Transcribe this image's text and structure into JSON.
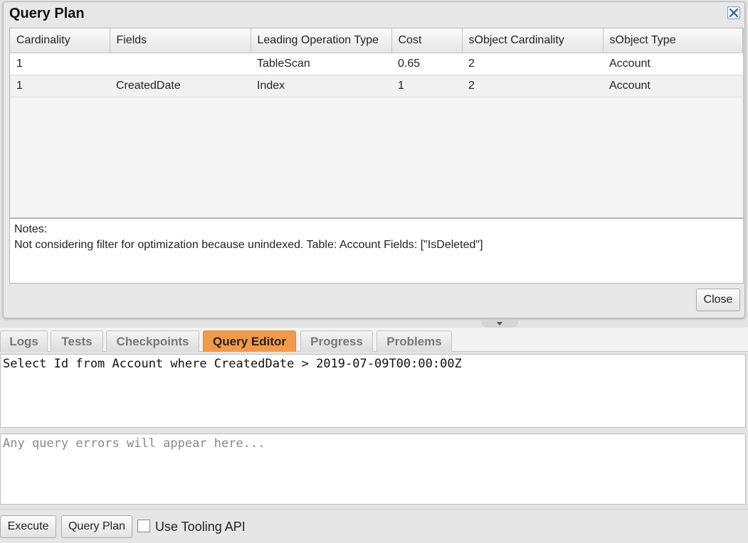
{
  "dialog": {
    "title": "Query Plan",
    "columns": [
      "Cardinality",
      "Fields",
      "Leading Operation Type",
      "Cost",
      "sObject Cardinality",
      "sObject Type"
    ],
    "rows": [
      [
        "1",
        "",
        "TableScan",
        "0.65",
        "2",
        "Account"
      ],
      [
        "1",
        "CreatedDate",
        "Index",
        "1",
        "2",
        "Account"
      ]
    ],
    "notes_label": "Notes:",
    "notes_text": "Not considering filter for optimization because unindexed. Table: Account Fields: [\"IsDeleted\"]",
    "close_label": "Close",
    "close_icon": "close-x-icon"
  },
  "tabs": [
    {
      "label": "Logs",
      "active": false
    },
    {
      "label": "Tests",
      "active": false
    },
    {
      "label": "Checkpoints",
      "active": false
    },
    {
      "label": "Query Editor",
      "active": true
    },
    {
      "label": "Progress",
      "active": false
    },
    {
      "label": "Problems",
      "active": false
    }
  ],
  "editor": {
    "query": "Select Id from Account where CreatedDate > 2019-07-09T00:00:00Z",
    "errors_placeholder": "Any query errors will appear here..."
  },
  "footer": {
    "execute_label": "Execute",
    "query_plan_label": "Query Plan",
    "tooling_label": "Use Tooling API",
    "tooling_checked": false
  },
  "colors": {
    "active_tab": "#f29a4a",
    "close_icon": "#2a5f9e"
  }
}
